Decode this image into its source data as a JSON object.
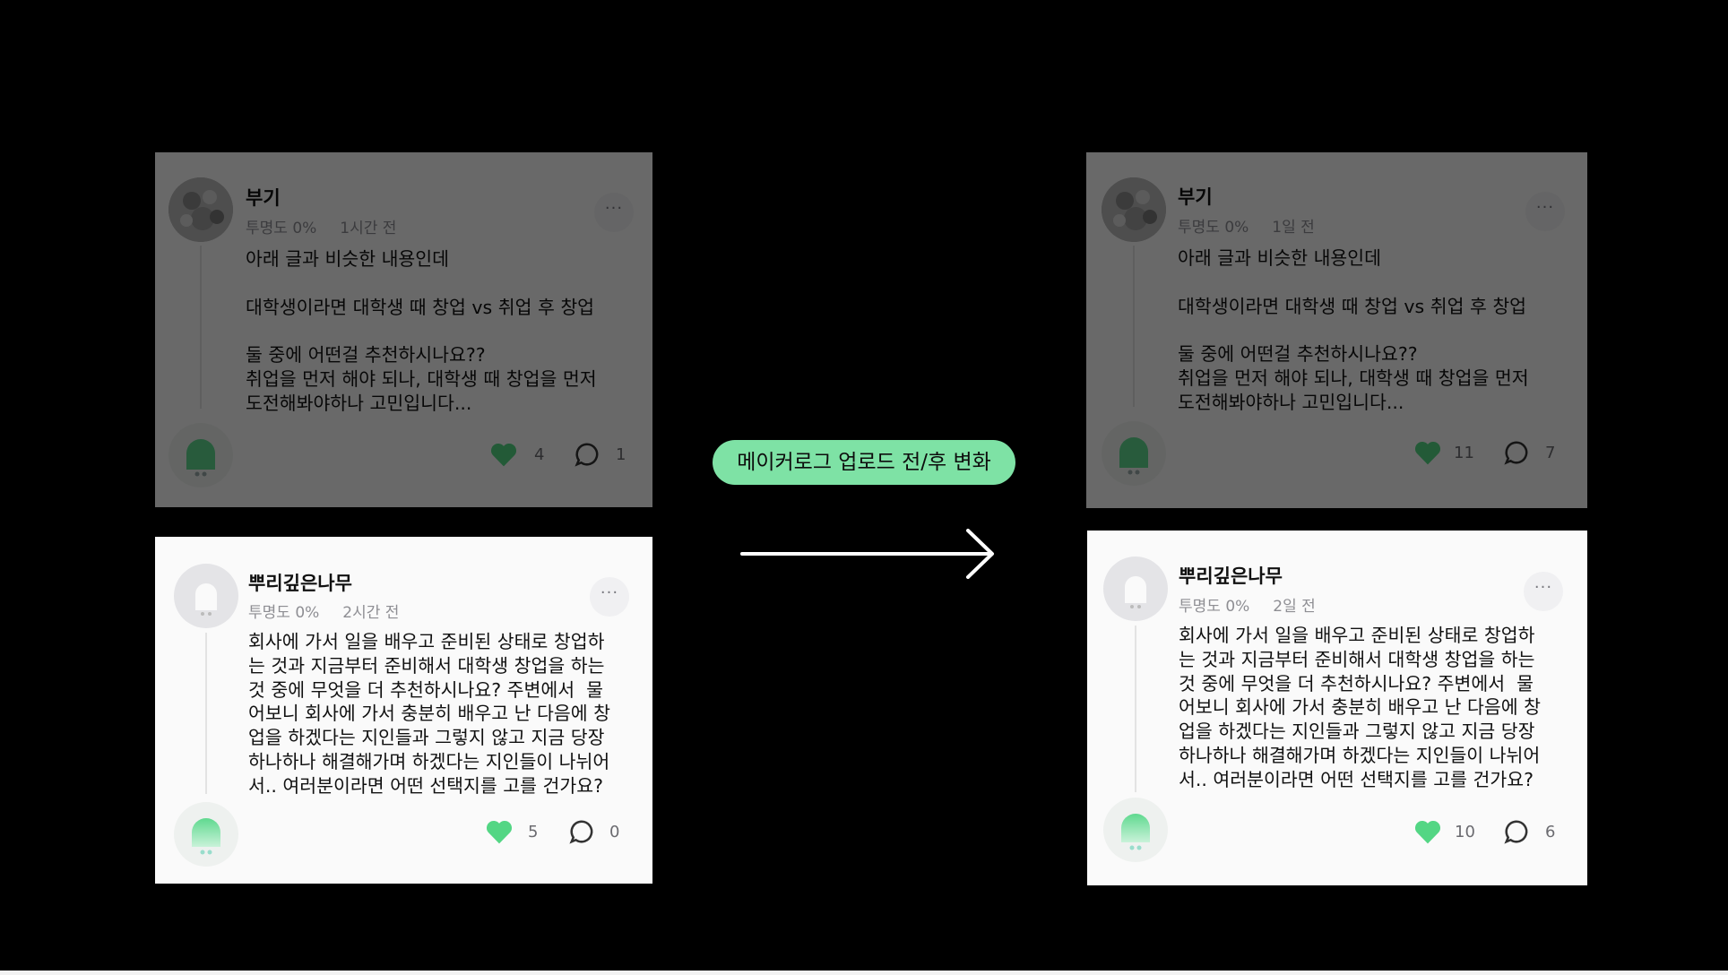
{
  "badge": {
    "label": "메이커로그 업로드 전/후 변화"
  },
  "colors": {
    "accent": "#7ee2a5",
    "heart": "#53d684",
    "bg": "#000000",
    "card": "#fafafa"
  },
  "before": {
    "post1": {
      "username": "부기",
      "transparency": "투명도 0%",
      "time": "1시간 전",
      "more": "···",
      "body": "아래 글과 비슷한 내용인데\n\n대학생이라면 대학생 때 창업 vs 취업 후 창업\n\n둘 중에 어떤걸 추천하시나요??\n취업을 먼저 해야 되나, 대학생 때 창업을 먼저\n도전해봐야하나 고민입니다...",
      "likes": "4",
      "comments": "1"
    },
    "post2": {
      "username": "뿌리깊은나무",
      "transparency": "투명도 0%",
      "time": "2시간 전",
      "more": "···",
      "body": "회사에 가서 일을 배우고 준비된 상태로 창업하\n는 것과 지금부터 준비해서 대학생 창업을 하는\n것 중에 무엇을 더 추천하시나요? 주변에서  물\n어보니 회사에 가서 충분히 배우고 난 다음에 창\n업을 하겠다는 지인들과 그렇지 않고 지금 당장\n하나하나 해결해가며 하겠다는 지인들이 나뉘어\n서.. 여러분이라면 어떤 선택지를 고를 건가요?",
      "likes": "5",
      "comments": "0"
    }
  },
  "after": {
    "post1": {
      "username": "부기",
      "transparency": "투명도 0%",
      "time": "1일 전",
      "more": "···",
      "body": "아래 글과 비슷한 내용인데\n\n대학생이라면 대학생 때 창업 vs 취업 후 창업\n\n둘 중에 어떤걸 추천하시나요??\n취업을 먼저 해야 되나, 대학생 때 창업을 먼저\n도전해봐야하나 고민입니다...",
      "likes": "11",
      "comments": "7"
    },
    "post2": {
      "username": "뿌리깊은나무",
      "transparency": "투명도 0%",
      "time": "2일 전",
      "more": "···",
      "body": "회사에 가서 일을 배우고 준비된 상태로 창업하\n는 것과 지금부터 준비해서 대학생 창업을 하는\n것 중에 무엇을 더 추천하시나요? 주변에서  물\n어보니 회사에 가서 충분히 배우고 난 다음에 창\n업을 하겠다는 지인들과 그렇지 않고 지금 당장\n하나하나 해결해가며 하겠다는 지인들이 나뉘어\n서.. 여러분이라면 어떤 선택지를 고를 건가요?",
      "likes": "10",
      "comments": "6"
    }
  }
}
